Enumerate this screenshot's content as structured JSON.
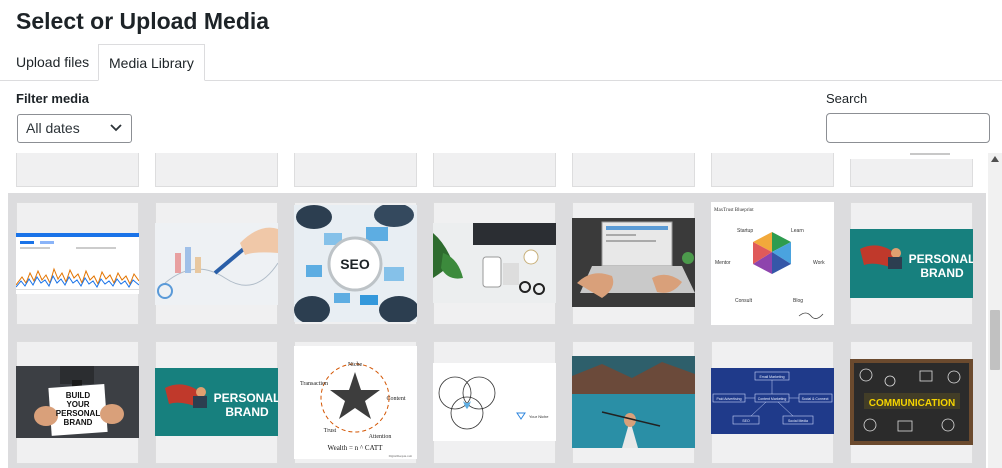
{
  "header": {
    "title": "Select or Upload Media"
  },
  "tabs": [
    {
      "label": "Upload files"
    },
    {
      "label": "Media Library"
    }
  ],
  "filters": {
    "label": "Filter media",
    "date_selected": "All dates"
  },
  "search": {
    "label": "Search",
    "placeholder": ""
  },
  "media_tiles": {
    "seo": {
      "text": "SEO"
    },
    "brand_a": {
      "line1": "PERSONAL",
      "line2": "BRAND"
    },
    "brand_b": {
      "line1": "PERSONAL",
      "line2": "BRAND"
    },
    "blueprint": {
      "title": "MaxTrust Blueprint",
      "labels": [
        "Startup",
        "Learn",
        "Mentor",
        "Work",
        "Consult",
        "Blog"
      ]
    },
    "build_brand": {
      "lines": [
        "BUILD",
        "YOUR",
        "PERSONAL",
        "BRAND"
      ]
    },
    "star": {
      "labels": [
        "Niche",
        "Transaction",
        "Content",
        "Trust",
        "Attention"
      ],
      "formula": "Wealth = n ^ CATT",
      "footer": "DigitalDeepak.com"
    },
    "venn": {
      "caption": "Your Niche"
    },
    "flow": {
      "boxes": [
        "Email Marketing",
        "Paid Advertising",
        "Content Marketing",
        "Social & Connect",
        "SEO",
        "Social Media"
      ]
    },
    "communication": {
      "text": "COMMUNICATION"
    }
  }
}
